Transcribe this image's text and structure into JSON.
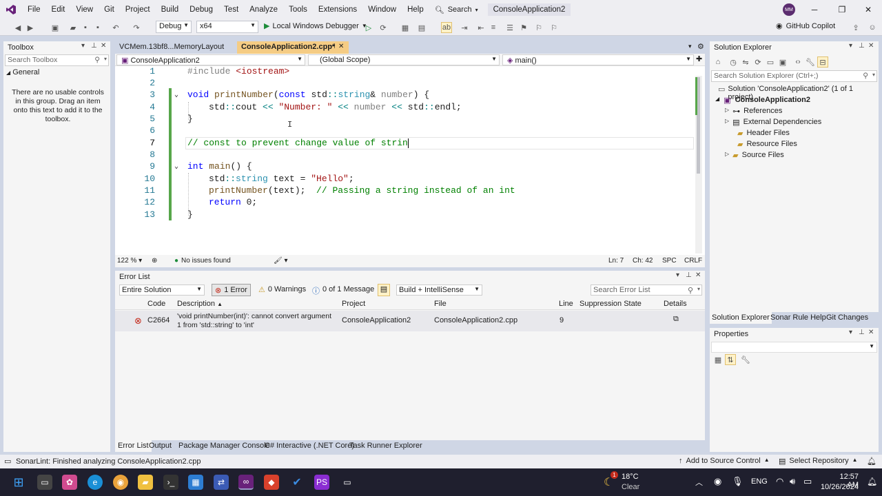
{
  "menubar": {
    "items": [
      "File",
      "Edit",
      "View",
      "Git",
      "Project",
      "Build",
      "Debug",
      "Test",
      "Analyze",
      "Tools",
      "Extensions",
      "Window",
      "Help"
    ],
    "search_label": "Search",
    "window_title": "ConsoleApplication2",
    "avatar_initials": "MM"
  },
  "toolbar": {
    "config": "Debug",
    "platform": "x64",
    "run_label": "Local Windows Debugger",
    "copilot_label": "GitHub Copilot"
  },
  "toolbox": {
    "title": "Toolbox",
    "search_placeholder": "Search Toolbox",
    "group": "General",
    "empty_text": "There are no usable controls in this group. Drag an item onto this text to add it to the toolbox."
  },
  "editor": {
    "tabs": [
      {
        "label": "VCMem.13bf8...MemoryLayout",
        "active": false
      },
      {
        "label": "ConsoleApplication2.cpp*",
        "active": true
      }
    ],
    "nav": {
      "project": "ConsoleApplication2",
      "scope": "(Global Scope)",
      "member": "main()"
    },
    "line_numbers": [
      "1",
      "2",
      "3",
      "4",
      "5",
      "6",
      "7",
      "8",
      "9",
      "10",
      "11",
      "12",
      "13"
    ],
    "zoom": "122 %",
    "issues": "No issues found",
    "ln": "Ln: 7",
    "ch": "Ch: 42",
    "spc": "SPC",
    "crlf": "CRLF"
  },
  "code": {
    "l1_pp": "#include ",
    "l1_hdr": "<iostream>",
    "l3_kw": "void ",
    "l3_fn": "printNumber",
    "l3_a": "(",
    "l3_kw2": "const ",
    "l3_ns": "std",
    "l3_op": "::",
    "l3_ty": "string",
    "l3_b": "& ",
    "l3_par": "number",
    "l3_c": ") {",
    "l4_a": "std",
    "l4_op1": "::",
    "l4_b": "cout ",
    "l4_op2": "<< ",
    "l4_str": "\"Number: \"",
    "l4_op3": " << ",
    "l4_par": "number",
    "l4_op4": " << ",
    "l4_c": "std",
    "l4_op5": "::",
    "l4_d": "endl;",
    "l5": "}",
    "l7_cm": "// const to prevent change value of strin",
    "l9_kw": "int ",
    "l9_fn": "main",
    "l9_rest": "() {",
    "l10_a": "std",
    "l10_op": "::",
    "l10_ty": "string",
    "l10_b": " text = ",
    "l10_str": "\"Hello\"",
    "l10_c": ";",
    "l11_fn": "printNumber",
    "l11_a": "(text);  ",
    "l11_cm": "// Passing a string instead of an int",
    "l12_kw": "return ",
    "l12_rest": "0;",
    "l13": "}"
  },
  "error_list": {
    "title": "Error List",
    "scope": "Entire Solution",
    "errors_label": "1 Error",
    "warnings_label": "0 Warnings",
    "messages_label": "0 of 1 Message",
    "build_filter": "Build + IntelliSense",
    "search_placeholder": "Search Error List",
    "columns": [
      "Code",
      "Description",
      "Project",
      "File",
      "Line",
      "Suppression State",
      "Details"
    ],
    "row": {
      "code": "C2664",
      "description": "'void printNumber(int)': cannot convert argument 1 from 'std::string' to 'int'",
      "project": "ConsoleApplication2",
      "file": "ConsoleApplication2.cpp",
      "line": "9"
    }
  },
  "bottom_tabs": [
    "Error List",
    "Output",
    "Package Manager Console",
    "C# Interactive (.NET Core)",
    "Task Runner Explorer"
  ],
  "solution_explorer": {
    "title": "Solution Explorer",
    "search_placeholder": "Search Solution Explorer (Ctrl+;)",
    "solution": "Solution 'ConsoleApplication2' (1 of 1 project)",
    "project": "ConsoleApplication2",
    "items": [
      "References",
      "External Dependencies",
      "Header Files",
      "Resource Files",
      "Source Files"
    ],
    "tabs": [
      "Solution Explorer",
      "Sonar Rule Help",
      "Git Changes"
    ]
  },
  "properties": {
    "title": "Properties"
  },
  "statusbar": {
    "message": "SonarLint: Finished analyzing ConsoleApplication2.cpp",
    "add_source": "Add to Source Control",
    "select_repo": "Select Repository"
  },
  "taskbar": {
    "temp": "18°C",
    "weather": "Clear",
    "badge": "1",
    "lang": "ENG",
    "time": "12:57 AM",
    "date": "10/26/2024"
  }
}
